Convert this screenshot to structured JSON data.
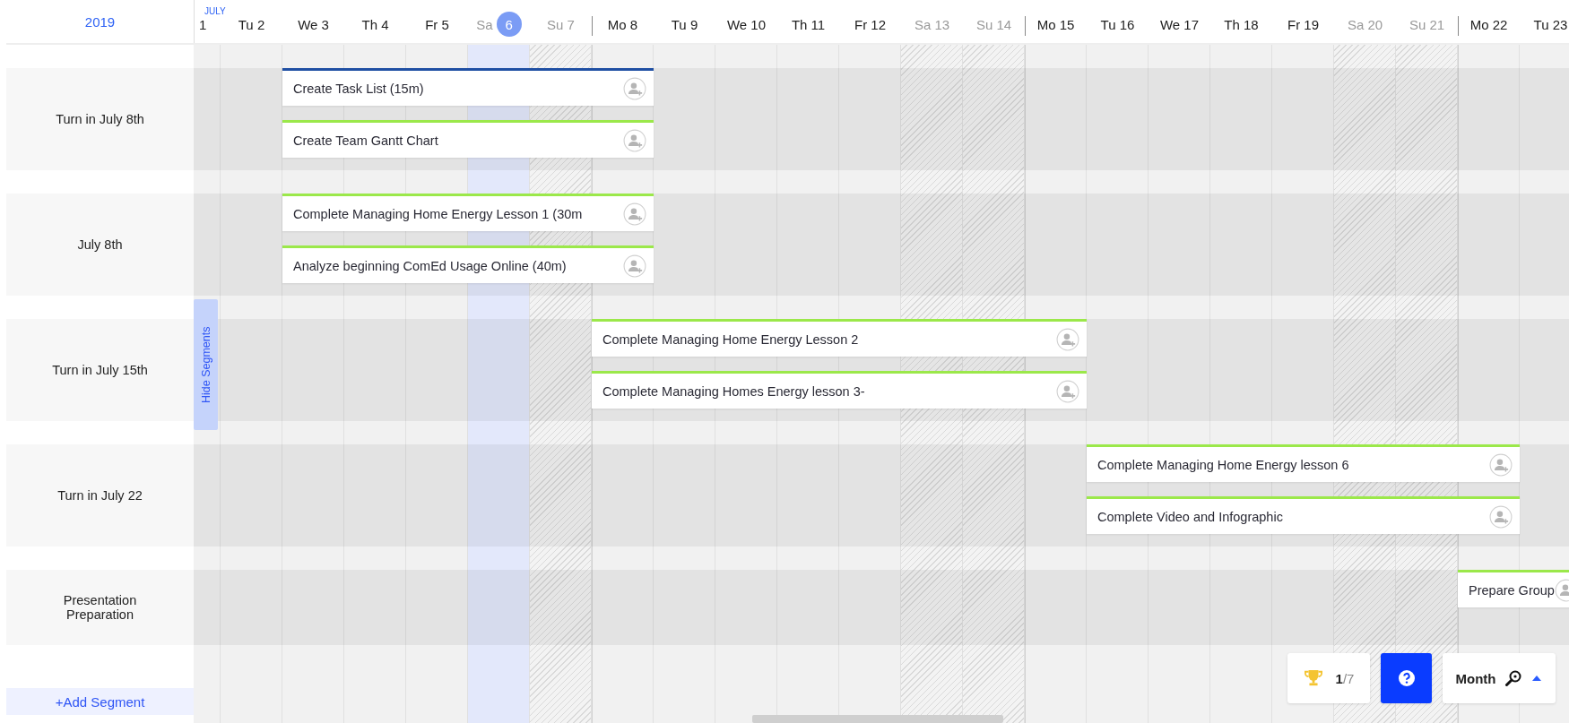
{
  "year": "2019",
  "days": [
    {
      "label": "1",
      "month": "JULY",
      "weekend": false,
      "today": false,
      "week_start": false
    },
    {
      "label": "Tu 2",
      "weekend": false,
      "today": false,
      "week_start": false
    },
    {
      "label": "We 3",
      "weekend": false,
      "today": false,
      "week_start": false
    },
    {
      "label": "Th 4",
      "weekend": false,
      "today": false,
      "week_start": false
    },
    {
      "label": "Fr 5",
      "weekend": false,
      "today": false,
      "week_start": false
    },
    {
      "label": "Sa",
      "today_number": "6",
      "weekend": true,
      "today": true,
      "week_start": false
    },
    {
      "label": "Su 7",
      "weekend": true,
      "today": false,
      "week_start": false
    },
    {
      "label": "Mo 8",
      "weekend": false,
      "today": false,
      "week_start": true
    },
    {
      "label": "Tu 9",
      "weekend": false,
      "today": false,
      "week_start": false
    },
    {
      "label": "We 10",
      "weekend": false,
      "today": false,
      "week_start": false
    },
    {
      "label": "Th 11",
      "weekend": false,
      "today": false,
      "week_start": false
    },
    {
      "label": "Fr 12",
      "weekend": false,
      "today": false,
      "week_start": false
    },
    {
      "label": "Sa 13",
      "weekend": true,
      "today": false,
      "week_start": false
    },
    {
      "label": "Su 14",
      "weekend": true,
      "today": false,
      "week_start": false
    },
    {
      "label": "Mo 15",
      "weekend": false,
      "today": false,
      "week_start": true
    },
    {
      "label": "Tu 16",
      "weekend": false,
      "today": false,
      "week_start": false
    },
    {
      "label": "We 17",
      "weekend": false,
      "today": false,
      "week_start": false
    },
    {
      "label": "Th 18",
      "weekend": false,
      "today": false,
      "week_start": false
    },
    {
      "label": "Fr 19",
      "weekend": false,
      "today": false,
      "week_start": false
    },
    {
      "label": "Sa 20",
      "weekend": true,
      "today": false,
      "week_start": false
    },
    {
      "label": "Su 21",
      "weekend": true,
      "today": false,
      "week_start": false
    },
    {
      "label": "Mo 22",
      "weekend": false,
      "today": false,
      "week_start": true
    },
    {
      "label": "Tu 23",
      "weekend": false,
      "today": false,
      "week_start": false
    }
  ],
  "segments": [
    {
      "name": "Turn in July 8th",
      "tasks": [
        {
          "title": "Create Task List (15m)",
          "color": "#1f4fa3"
        },
        {
          "title": "Create Team Gantt Chart",
          "color": "#9be84a"
        }
      ]
    },
    {
      "name": "July 8th",
      "tasks": [
        {
          "title": "Complete Managing Home Energy Lesson 1 (30m",
          "color": "#9be84a"
        },
        {
          "title": "Analyze beginning ComEd Usage Online (40m)",
          "color": "#9be84a"
        }
      ]
    },
    {
      "name": "Turn in July 15th",
      "tasks": [
        {
          "title": "Complete Managing Home Energy Lesson 2",
          "color": "#9be84a"
        },
        {
          "title": "Complete Managing Homes Energy lesson 3-",
          "color": "#9be84a"
        }
      ]
    },
    {
      "name": "Turn in July 22",
      "tasks": [
        {
          "title": "Complete Managing Home Energy lesson 6",
          "color": "#9be84a"
        },
        {
          "title": "Complete Video and Infographic",
          "color": "#9be84a"
        }
      ]
    },
    {
      "name": "Presentation Preparation",
      "tasks": [
        {
          "title": "Prepare Group",
          "color": "#9be84a"
        }
      ]
    }
  ],
  "hide_segments": "Hide Segments",
  "add_segment": "+Add Segment",
  "score": "**1**/7",
  "zoom": {
    "label": "Month",
    "expanded": false
  }
}
